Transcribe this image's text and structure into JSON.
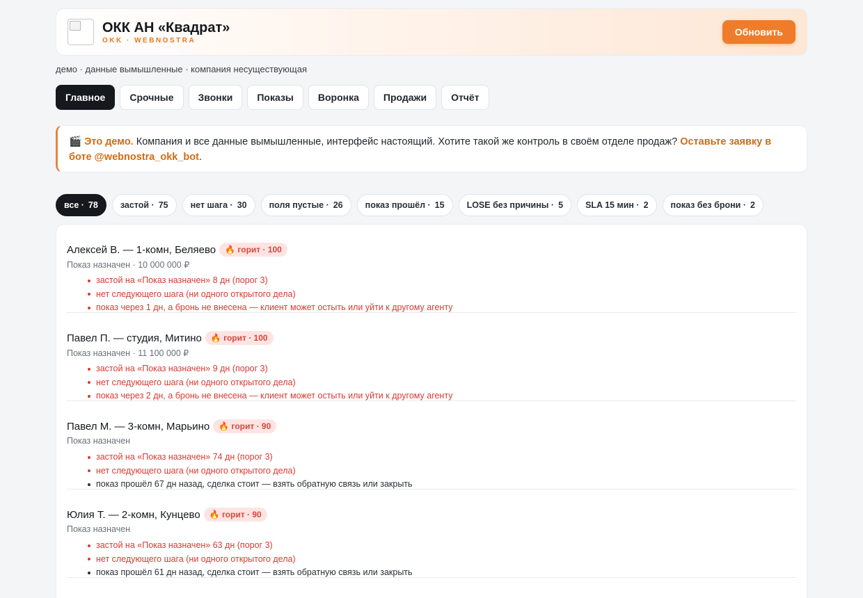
{
  "header": {
    "title": "ОКК АН «Квадрат»",
    "subtitle": "OKK · WEBNOSTRA",
    "refresh_label": "Обновить"
  },
  "demo_note": "демо · данные вымышленные · компания несуществующая",
  "tabs": [
    {
      "label": "Главное",
      "active": true
    },
    {
      "label": "Срочные"
    },
    {
      "label": "Звонки"
    },
    {
      "label": "Показы"
    },
    {
      "label": "Воронка"
    },
    {
      "label": "Продажи"
    },
    {
      "label": "Отчёт"
    }
  ],
  "banner": {
    "icon": "🎬",
    "lead": "Это демо.",
    "text": " Компания и все данные вымышленные, интерфейс настоящий. Хотите такой же контроль в своём отделе продаж? ",
    "cta": "Оставьте заявку в боте @webnostra_okk_bot",
    "tail": "."
  },
  "filters": [
    {
      "label": "все ·",
      "count": "78",
      "active": true
    },
    {
      "label": "застой ·",
      "count": "75"
    },
    {
      "label": "нет шага ·",
      "count": "30"
    },
    {
      "label": "поля пустые ·",
      "count": "26"
    },
    {
      "label": "показ прошёл ·",
      "count": "15"
    },
    {
      "label": "LOSE без причины ·",
      "count": "5"
    },
    {
      "label": "SLA 15 мин ·",
      "count": "2"
    },
    {
      "label": "показ без брони ·",
      "count": "2"
    }
  ],
  "deals": [
    {
      "title": "Алексей В. — 1-комн, Беляево",
      "badge": "🔥 горит · 100",
      "sub": "Показ назначен · 10 000 000 ₽",
      "issues": [
        {
          "text": "застой на «Показ назначен» 8 дн (порог 3)",
          "alert": true
        },
        {
          "text": "нет следующего шага (ни одного открытого дела)",
          "alert": true
        },
        {
          "text": "показ через 1 дн, а бронь не внесена — клиент может остыть или уйти к другому агенту",
          "alert": true
        }
      ]
    },
    {
      "title": "Павел П. — студия, Митино",
      "badge": "🔥 горит · 100",
      "sub": "Показ назначен · 11 100 000 ₽",
      "issues": [
        {
          "text": "застой на «Показ назначен» 9 дн (порог 3)",
          "alert": true
        },
        {
          "text": "нет следующего шага (ни одного открытого дела)",
          "alert": true
        },
        {
          "text": "показ через 2 дн, а бронь не внесена — клиент может остыть или уйти к другому агенту",
          "alert": true
        }
      ]
    },
    {
      "title": "Павел М. — 3-комн, Марьино",
      "badge": "🔥 горит · 90",
      "sub": "Показ назначен",
      "issues": [
        {
          "text": "застой на «Показ назначен» 74 дн (порог 3)",
          "alert": true
        },
        {
          "text": "нет следующего шага (ни одного открытого дела)",
          "alert": true
        },
        {
          "text": "показ прошёл 67 дн назад, сделка стоит — взять обратную связь или закрыть",
          "alert": false
        }
      ]
    },
    {
      "title": "Юлия Т. — 2-комн, Кунцево",
      "badge": "🔥 горит · 90",
      "sub": "Показ назначен",
      "issues": [
        {
          "text": "застой на «Показ назначен» 63 дн (порог 3)",
          "alert": true
        },
        {
          "text": "нет следующего шага (ни одного открытого дела)",
          "alert": true
        },
        {
          "text": "показ прошёл 61 дн назад, сделка стоит — взять обратную связь или закрыть",
          "alert": false
        }
      ]
    }
  ]
}
